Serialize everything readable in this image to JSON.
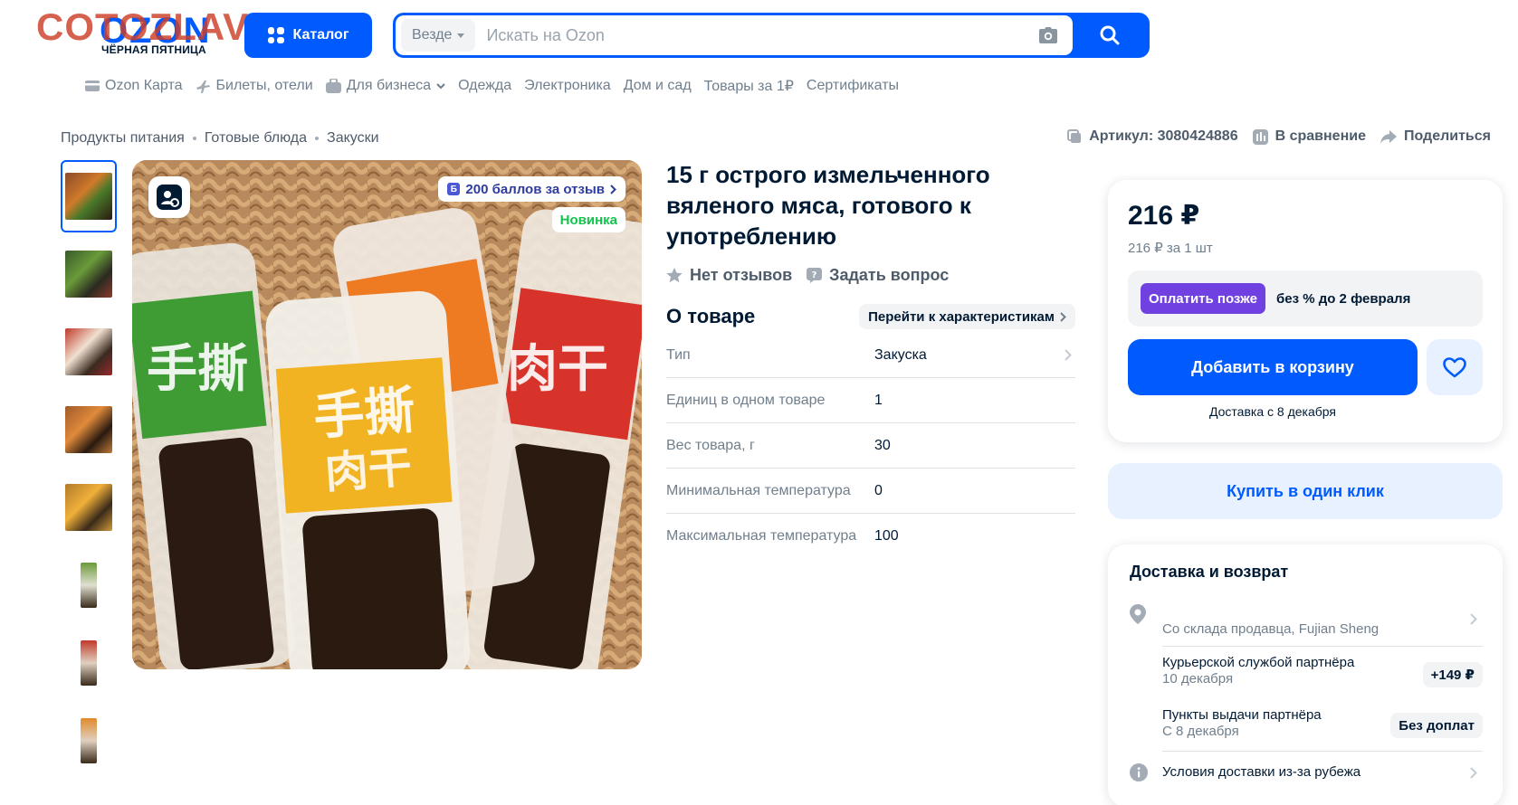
{
  "header": {
    "watermark": "COTOZLAVE.RU",
    "logo": "OZON",
    "logo_subtitle": "ЧЁРНАЯ ПЯТНИЦА",
    "catalog_label": "Каталог",
    "search": {
      "scope": "Везде",
      "placeholder": "Искать на Ozon"
    }
  },
  "nav": [
    {
      "label": "Ozon Карта",
      "icon": "card-icon"
    },
    {
      "label": "Билеты, отели",
      "icon": "plane-icon"
    },
    {
      "label": "Для бизнеса",
      "icon": "business-icon"
    },
    {
      "label": "Одежда"
    },
    {
      "label": "Электроника"
    },
    {
      "label": "Дом и сад"
    },
    {
      "label": "Товары за 1₽"
    },
    {
      "label": "Сертификаты"
    }
  ],
  "breadcrumb": [
    "Продукты питания",
    "Готовые блюда",
    "Закуски"
  ],
  "meta": {
    "article": "Артикул: 3080424886",
    "compare": "В сравнение",
    "share": "Поделиться"
  },
  "gallery": {
    "bonus": "200 баллов за отзыв",
    "new_badge": "Новинка",
    "thumb_colors": [
      "#8a4a2a",
      "#3a5a2a",
      "#9a2a2a",
      "#a05a2a",
      "#b07a2a",
      "#6a8a3a",
      "#9a3a2a",
      "#a0602a",
      "#c08a2a"
    ]
  },
  "product": {
    "title": "15 г острого измельченного вяленого мяса, готового к употреблению",
    "no_reviews": "Нет отзывов",
    "ask_question": "Задать вопрос",
    "about_title": "О товаре",
    "to_specs": "Перейти к характеристикам",
    "specs": [
      {
        "key": "Тип",
        "value": "Закуска"
      },
      {
        "key": "Единиц в одном товаре",
        "value": "1"
      },
      {
        "key": "Вес товара, г",
        "value": "30"
      },
      {
        "key": "Минимальная температура",
        "value": "0"
      },
      {
        "key": "Максимальная температура",
        "value": "100"
      }
    ]
  },
  "buy": {
    "price": "216 ₽",
    "unit_price": "216 ₽ за 1 шт",
    "pay_later_badge": "Оплатить позже",
    "pay_later_text": "без % до 2 февраля",
    "add_to_cart": "Добавить в корзину",
    "delivery_note": "Доставка с 8 декабря",
    "one_click": "Купить в один клик"
  },
  "delivery": {
    "title": "Доставка и возврат",
    "from": "Со склада продавца, Fujian Sheng",
    "courier": "Курьерской службой партнёра",
    "courier_date": "10 декабря",
    "courier_price": "+149 ₽",
    "pickup": "Пункты выдачи партнёра",
    "pickup_date": "С 8 декабря",
    "pickup_price": "Без доплат",
    "abroad": "Условия доставки из-за рубежа"
  },
  "colors": {
    "accent": "#005bff",
    "pay_later": "#7040e0",
    "new_badge": "#10c44c",
    "watermark": "#cd3e28"
  }
}
